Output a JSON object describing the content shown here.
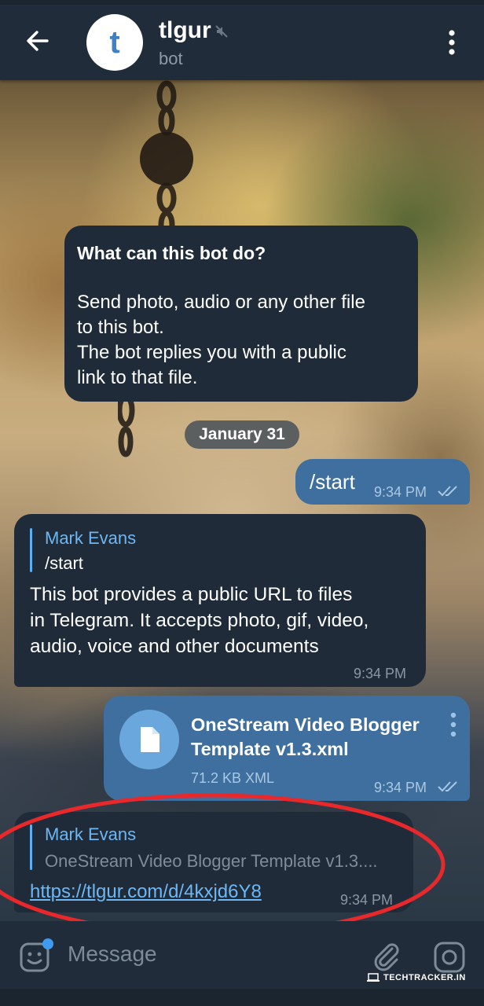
{
  "header": {
    "title": "tlgur",
    "subtitle": "bot",
    "avatar_letter": "t",
    "icons": [
      "arrow-left-icon",
      "muted-icon",
      "vertical-dots-icon"
    ]
  },
  "bot_info": {
    "title": "What can this bot do?",
    "text": "Send photo, audio or any other file\nto this bot.\nThe bot replies you with a public\nlink to that file."
  },
  "date_separator": "January 31",
  "messages": [
    {
      "direction": "out",
      "text": "/start",
      "time": "9:34 PM",
      "status_icon": "double-check-icon"
    },
    {
      "direction": "in",
      "reply_to": {
        "name": "Mark Evans",
        "text": "/start"
      },
      "text": "This bot provides a public URL to files\nin Telegram. It accepts photo, gif, video,\naudio, voice and other documents",
      "time": "9:34 PM"
    },
    {
      "direction": "out",
      "file": {
        "name": "OneStream Video Blogger\nTemplate v1.3.xml",
        "meta": "71.2 KB XML",
        "icon": "file-icon"
      },
      "time": "9:34 PM",
      "status_icon": "double-check-icon"
    },
    {
      "direction": "in",
      "reply_to": {
        "name": "Mark Evans",
        "text": "OneStream Video Blogger Template v1.3...."
      },
      "link": "https://tlgur.com/d/4kxjd6Y8",
      "time": "9:34 PM"
    }
  ],
  "input": {
    "placeholder": "Message",
    "icons": [
      "sticker-icon",
      "paperclip-icon",
      "camera-icon"
    ]
  },
  "watermark": "TECHTRACKER.IN",
  "colors": {
    "header_bg": "#202c3a",
    "bubble_in": "#1f2b38",
    "bubble_out": "#3f6f9e",
    "accent": "#6db7f5",
    "annotation": "#e8282b"
  }
}
